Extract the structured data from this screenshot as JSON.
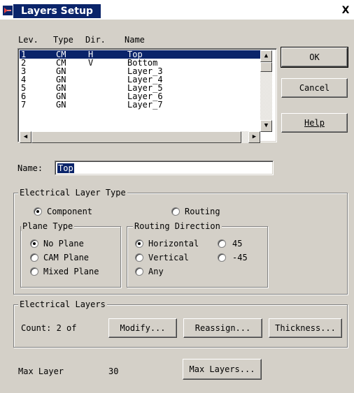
{
  "window": {
    "title": "Layers Setup",
    "close_label": "X"
  },
  "list": {
    "headers": {
      "lev": "Lev.",
      "type": "Type",
      "dir": "Dir.",
      "name": "Name"
    },
    "rows": [
      {
        "lev": "1",
        "type": "CM",
        "dir": "H",
        "name": "Top",
        "selected": true
      },
      {
        "lev": "2",
        "type": "CM",
        "dir": "V",
        "name": "Bottom"
      },
      {
        "lev": "3",
        "type": "GN",
        "dir": "",
        "name": "Layer_3"
      },
      {
        "lev": "4",
        "type": "GN",
        "dir": "",
        "name": "Layer_4"
      },
      {
        "lev": "5",
        "type": "GN",
        "dir": "",
        "name": "Layer_5"
      },
      {
        "lev": "6",
        "type": "GN",
        "dir": "",
        "name": "Layer_6"
      },
      {
        "lev": "7",
        "type": "GN",
        "dir": "",
        "name": "Layer_7"
      }
    ]
  },
  "buttons": {
    "ok": "OK",
    "cancel": "Cancel",
    "help": "Help"
  },
  "name_field": {
    "label": "Name:",
    "value": "Top"
  },
  "electrical_layer_type": {
    "title": "Electrical  Layer Type",
    "component": "Component",
    "routing": "Routing",
    "selected": "component"
  },
  "plane_type": {
    "title": "Plane Type",
    "options": [
      "No Plane",
      "CAM Plane",
      "Mixed Plane"
    ],
    "selected": "No Plane"
  },
  "routing_direction": {
    "title": "Routing Direction",
    "horizontal": "Horizontal",
    "vertical": "Vertical",
    "any": "Any",
    "deg45": "45",
    "degm45": "-45",
    "selected": "Horizontal"
  },
  "electrical_layers": {
    "title": "Electrical Layers",
    "count_label": "Count:  2 of",
    "modify": "Modify...",
    "reassign": "Reassign...",
    "thickness": "Thickness..."
  },
  "max_layer": {
    "label": "Max Layer",
    "value": "30",
    "button": "Max Layers..."
  },
  "colors": {
    "selection": "#0a246a",
    "face": "#d4d0c8"
  }
}
